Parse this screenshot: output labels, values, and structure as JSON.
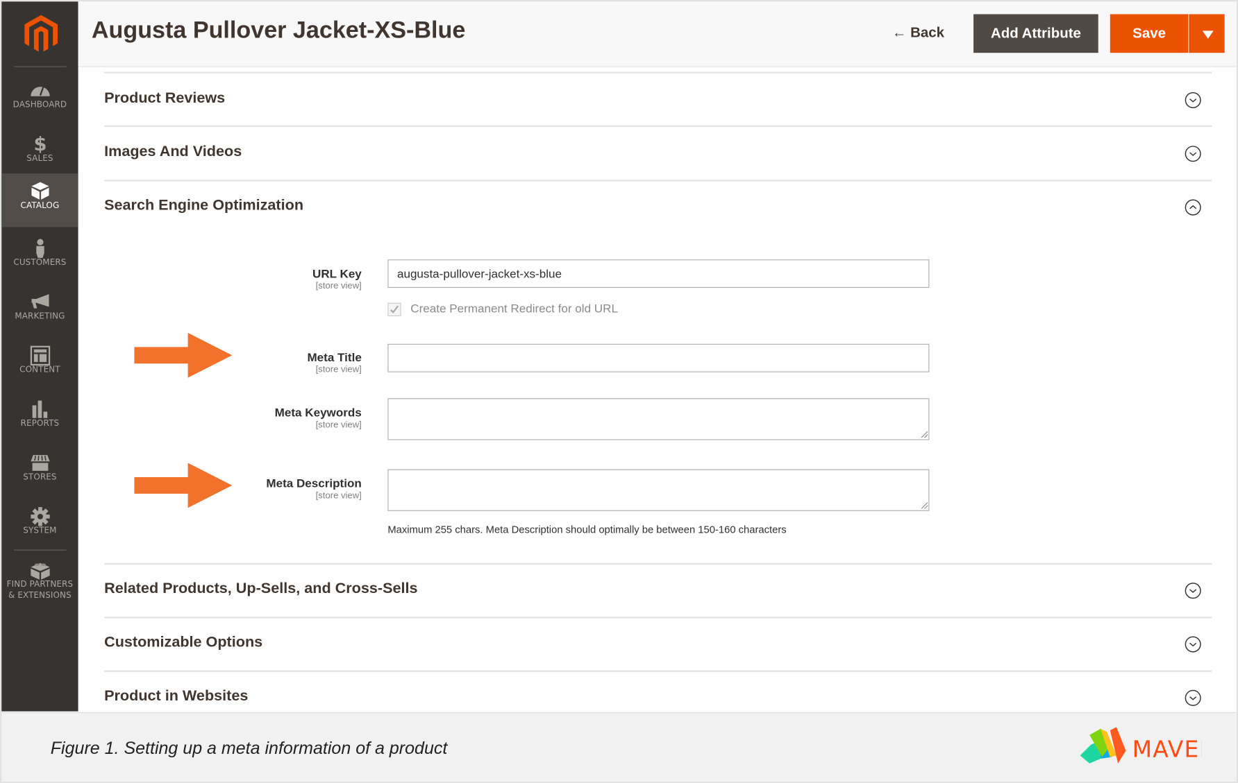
{
  "header": {
    "title": "Augusta Pullover Jacket-XS-Blue",
    "back_label": "Back",
    "add_attribute_label": "Add Attribute",
    "save_label": "Save"
  },
  "sidebar": {
    "items": [
      {
        "label": "DASHBOARD",
        "icon": "dashboard-icon"
      },
      {
        "label": "SALES",
        "icon": "dollar-icon"
      },
      {
        "label": "CATALOG",
        "icon": "box-icon",
        "active": true
      },
      {
        "label": "CUSTOMERS",
        "icon": "person-icon"
      },
      {
        "label": "MARKETING",
        "icon": "megaphone-icon"
      },
      {
        "label": "CONTENT",
        "icon": "layout-icon"
      },
      {
        "label": "REPORTS",
        "icon": "bar-chart-icon"
      },
      {
        "label": "STORES",
        "icon": "storefront-icon"
      },
      {
        "label": "SYSTEM",
        "icon": "gear-icon"
      },
      {
        "label": "FIND PARTNERS",
        "label2": "& EXTENSIONS",
        "icon": "lego-brick-icon"
      }
    ]
  },
  "sections": [
    {
      "title": "Product Reviews",
      "state": "collapsed"
    },
    {
      "title": "Images And Videos",
      "state": "collapsed"
    },
    {
      "title": "Search Engine Optimization",
      "state": "expanded"
    },
    {
      "title": "Related Products, Up-Sells, and Cross-Sells",
      "state": "collapsed"
    },
    {
      "title": "Customizable Options",
      "state": "collapsed"
    },
    {
      "title": "Product in Websites",
      "state": "collapsed"
    }
  ],
  "seo": {
    "scope": "[store view]",
    "url_key": {
      "label": "URL Key",
      "value": "augusta-pullover-jacket-xs-blue"
    },
    "redirect": {
      "label": "Create Permanent Redirect for old URL",
      "checked": true
    },
    "meta_title": {
      "label": "Meta Title",
      "value": ""
    },
    "meta_keywords": {
      "label": "Meta Keywords",
      "value": ""
    },
    "meta_description": {
      "label": "Meta Description",
      "value": "",
      "note": "Maximum 255 chars. Meta Description should optimally be between 150-160 characters"
    }
  },
  "caption": "Figure 1. Setting up a meta information of a product",
  "brand": {
    "logo_text": "MAVEN"
  },
  "colors": {
    "accent": "#eb5202",
    "sidebar": "#373330",
    "arrow": "#f2722c"
  }
}
